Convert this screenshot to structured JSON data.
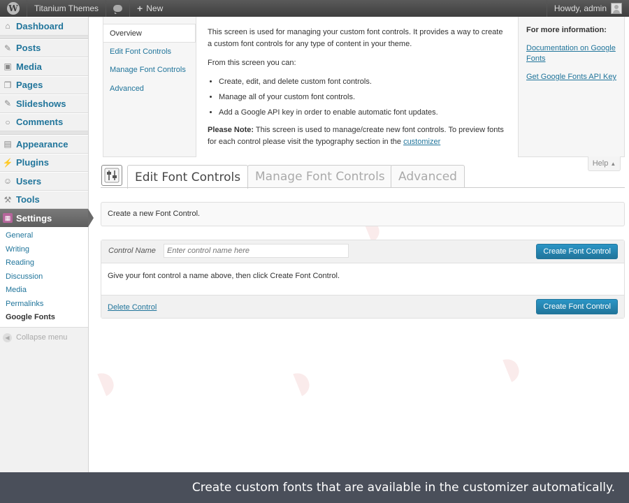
{
  "admin_bar": {
    "site_name": "Titanium Themes",
    "new_label": "New",
    "greeting": "Howdy, admin"
  },
  "menu": {
    "items": [
      {
        "label": "Dashboard",
        "icon": "dashboard-icon"
      },
      {
        "label": "Posts",
        "icon": "pin-icon"
      },
      {
        "label": "Media",
        "icon": "media-icon"
      },
      {
        "label": "Pages",
        "icon": "pages-icon"
      },
      {
        "label": "Slideshows",
        "icon": "pin-icon"
      },
      {
        "label": "Comments",
        "icon": "comment-icon"
      },
      {
        "label": "Appearance",
        "icon": "appearance-icon"
      },
      {
        "label": "Plugins",
        "icon": "plugin-icon"
      },
      {
        "label": "Users",
        "icon": "users-icon"
      },
      {
        "label": "Tools",
        "icon": "tools-icon"
      },
      {
        "label": "Settings",
        "icon": "settings-icon"
      }
    ],
    "settings_sub": [
      "General",
      "Writing",
      "Reading",
      "Discussion",
      "Media",
      "Permalinks",
      "Google Fonts"
    ],
    "collapse": "Collapse menu"
  },
  "help": {
    "tabs": [
      "Overview",
      "Edit Font Controls",
      "Manage Font Controls",
      "Advanced"
    ],
    "intro": "This screen is used for managing your custom font controls. It provides a way to create a custom font controls for any type of content in your theme.",
    "from_here": "From this screen you can:",
    "bullets": [
      "Create, edit, and delete custom font controls.",
      "Manage all of your custom font controls.",
      "Add a Google API key in order to enable automatic font updates."
    ],
    "note_label": "Please Note:",
    "note_text": " This screen is used to manage/create new font controls. To preview fonts for each control please visit the typography section in the ",
    "note_link": "customizer",
    "side_heading": "For more information:",
    "side_links": [
      "Documentation on Google Fonts",
      "Get Google Fonts API Key"
    ],
    "help_button": "Help"
  },
  "tabs": [
    "Edit Font Controls",
    "Manage Font Controls",
    "Advanced"
  ],
  "intro_text": "Create a new Font Control.",
  "form": {
    "label": "Control Name",
    "value": "",
    "placeholder": "Enter control name here",
    "button": "Create Font Control",
    "hint": "Give your font control a name above, then click Create Font Control.",
    "delete": "Delete Control"
  },
  "caption": "Create custom fonts that are available in the customizer automatically.",
  "colors": {
    "accent": "#21759b",
    "current_menu": "#6a6a6a",
    "caption_bg": "#4a4f5a"
  }
}
